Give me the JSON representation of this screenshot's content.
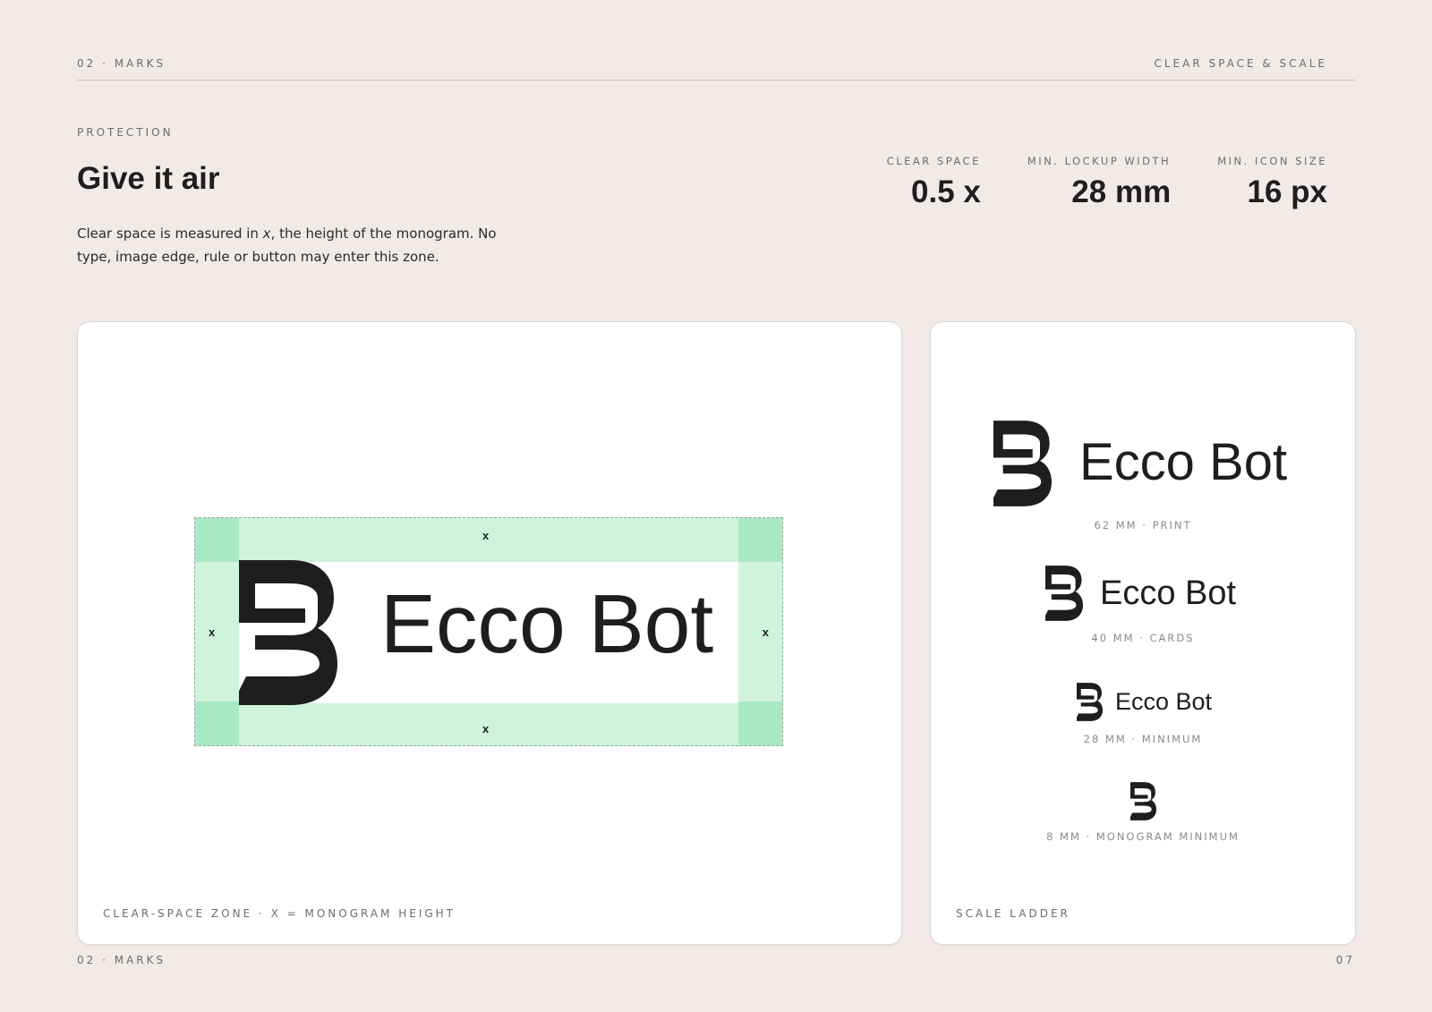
{
  "header": {
    "section": "02 · MARKS",
    "topic": "CLEAR SPACE & SCALE"
  },
  "intro": {
    "eyebrow": "PROTECTION",
    "title": "Give it air",
    "description_pre": "Clear space is measured in ",
    "description_var": "x",
    "description_post": ", the height of the monogram. No type, image edge, rule or button may enter this zone."
  },
  "stats": [
    {
      "label": "CLEAR SPACE",
      "value": "0.5 x"
    },
    {
      "label": "MIN. LOCKUP WIDTH",
      "value": "28 mm"
    },
    {
      "label": "MIN. ICON SIZE",
      "value": "16 px"
    }
  ],
  "clear_space_panel": {
    "wordmark": "Ecco Bot",
    "x_marker": "x",
    "caption": "CLEAR-SPACE ZONE · X = MONOGRAM HEIGHT",
    "zone_color": "#cff3dd",
    "corner_color": "#a8e9c3"
  },
  "scale_ladder": {
    "caption": "SCALE LADDER",
    "wordmark": "Ecco Bot",
    "rungs": [
      {
        "label": "62 MM · PRINT"
      },
      {
        "label": "40 MM · CARDS"
      },
      {
        "label": "28 MM · MINIMUM"
      },
      {
        "label": "8 MM · MONOGRAM MINIMUM"
      }
    ]
  },
  "footer": {
    "section": "02 · MARKS",
    "page": "07"
  },
  "colors": {
    "background": "#f2eae8",
    "ink": "#1e1e1e"
  }
}
